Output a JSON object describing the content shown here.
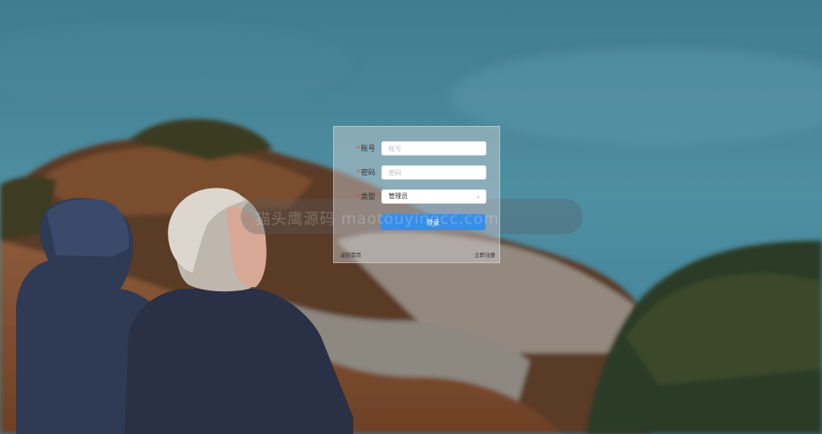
{
  "form": {
    "account_label": "账号",
    "account_placeholder": "账号",
    "password_label": "密码",
    "password_placeholder": "密码",
    "type_label": "类型",
    "type_selected": "管理员",
    "login_label": "登录",
    "back_home_label": "返回首页",
    "register_label": "立即注册",
    "required_mark": "*"
  },
  "watermark": {
    "text": "猫头鹰源码 maotouyingcc.com"
  },
  "colors": {
    "accent": "#3a8ee6",
    "required": "#e0443a"
  },
  "icons": {
    "select_arrow": "chevron-down-icon"
  }
}
